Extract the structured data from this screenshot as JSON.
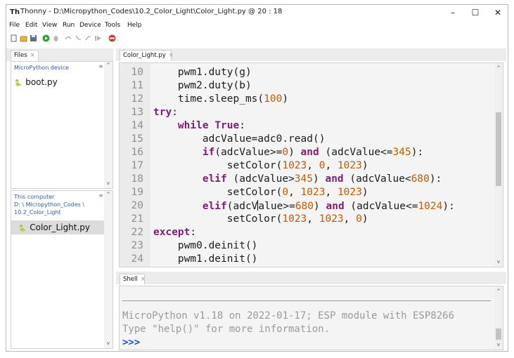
{
  "window": {
    "title": "Thonny  -  D:\\Micropython_Codes\\10.2_Color_Light\\Color_Light.py  @  20 : 18",
    "minimize": "–",
    "maximize": "☐",
    "close": "✕"
  },
  "menu": [
    "File",
    "Edit",
    "View",
    "Run",
    "Device",
    "Tools",
    "Help"
  ],
  "toolbar": {
    "icons": [
      "new-file-icon",
      "open-file-icon",
      "save-icon",
      "run-icon",
      "debug-icon",
      "step-over-icon",
      "step-into-icon",
      "step-out-icon",
      "resume-icon",
      "stop-icon"
    ],
    "run_color": "#2aa32a",
    "stop_color": "#d83a2a"
  },
  "files_tab": {
    "label": "Files",
    "close": "×"
  },
  "device_panel": {
    "header": "MicroPython device",
    "files": [
      "boot.py"
    ]
  },
  "computer_panel": {
    "header_lines": [
      "This computer",
      "D: \\ Micropython_Codes \\",
      "10.2_Color_Light"
    ],
    "files": [
      "Color_Light.py"
    ]
  },
  "editor_tab": {
    "label": "Color_Light.py",
    "close": "×"
  },
  "editor": {
    "lines": [
      {
        "n": "10",
        "indent": "    ",
        "parts": [
          {
            "t": "pwm1.duty(g)",
            "c": ""
          }
        ]
      },
      {
        "n": "11",
        "indent": "    ",
        "parts": [
          {
            "t": "pwm2.duty(b)",
            "c": ""
          }
        ]
      },
      {
        "n": "12",
        "indent": "    ",
        "parts": [
          {
            "t": "time.sleep_ms(",
            "c": ""
          },
          {
            "t": "100",
            "c": "num"
          },
          {
            "t": ")",
            "c": ""
          }
        ]
      },
      {
        "n": "13",
        "indent": "",
        "parts": [
          {
            "t": "try",
            "c": "kw"
          },
          {
            "t": ":",
            "c": ""
          }
        ]
      },
      {
        "n": "14",
        "indent": "    ",
        "parts": [
          {
            "t": "while",
            "c": "kw"
          },
          {
            "t": " ",
            "c": ""
          },
          {
            "t": "True",
            "c": "kw"
          },
          {
            "t": ":",
            "c": ""
          }
        ]
      },
      {
        "n": "15",
        "indent": "        ",
        "parts": [
          {
            "t": "adcValue=adc0.read()",
            "c": ""
          }
        ]
      },
      {
        "n": "16",
        "indent": "        ",
        "parts": [
          {
            "t": "if",
            "c": "kw"
          },
          {
            "t": "(adcValue>=",
            "c": ""
          },
          {
            "t": "0",
            "c": "num"
          },
          {
            "t": ") ",
            "c": ""
          },
          {
            "t": "and",
            "c": "kw"
          },
          {
            "t": " (adcValue<=",
            "c": ""
          },
          {
            "t": "345",
            "c": "num"
          },
          {
            "t": "):",
            "c": ""
          }
        ]
      },
      {
        "n": "17",
        "indent": "            ",
        "parts": [
          {
            "t": "setColor(",
            "c": ""
          },
          {
            "t": "1023",
            "c": "num"
          },
          {
            "t": ", ",
            "c": ""
          },
          {
            "t": "0",
            "c": "num"
          },
          {
            "t": ", ",
            "c": ""
          },
          {
            "t": "1023",
            "c": "num"
          },
          {
            "t": ")",
            "c": ""
          }
        ]
      },
      {
        "n": "18",
        "indent": "        ",
        "parts": [
          {
            "t": "elif",
            "c": "kw"
          },
          {
            "t": " (adcValue>",
            "c": ""
          },
          {
            "t": "345",
            "c": "num"
          },
          {
            "t": ") ",
            "c": ""
          },
          {
            "t": "and",
            "c": "kw"
          },
          {
            "t": " (adcValue<",
            "c": ""
          },
          {
            "t": "680",
            "c": "num"
          },
          {
            "t": "):",
            "c": ""
          }
        ]
      },
      {
        "n": "19",
        "indent": "            ",
        "parts": [
          {
            "t": "setColor(",
            "c": ""
          },
          {
            "t": "0",
            "c": "num"
          },
          {
            "t": ", ",
            "c": ""
          },
          {
            "t": "1023",
            "c": "num"
          },
          {
            "t": ", ",
            "c": ""
          },
          {
            "t": "1023",
            "c": "num"
          },
          {
            "t": ")",
            "c": ""
          }
        ]
      },
      {
        "n": "20",
        "indent": "        ",
        "parts": [
          {
            "t": "elif",
            "c": "kw"
          },
          {
            "t": "(adcV",
            "c": ""
          },
          {
            "t": "|",
            "c": "cursor"
          },
          {
            "t": "alue>=",
            "c": ""
          },
          {
            "t": "680",
            "c": "num"
          },
          {
            "t": ") ",
            "c": ""
          },
          {
            "t": "and",
            "c": "kw"
          },
          {
            "t": " (adcValue<=",
            "c": ""
          },
          {
            "t": "1024",
            "c": "num"
          },
          {
            "t": "):",
            "c": ""
          }
        ]
      },
      {
        "n": "21",
        "indent": "            ",
        "parts": [
          {
            "t": "setColor(",
            "c": ""
          },
          {
            "t": "1023",
            "c": "num"
          },
          {
            "t": ", ",
            "c": ""
          },
          {
            "t": "1023",
            "c": "num"
          },
          {
            "t": ", ",
            "c": ""
          },
          {
            "t": "0",
            "c": "num"
          },
          {
            "t": ")",
            "c": ""
          }
        ]
      },
      {
        "n": "22",
        "indent": "",
        "parts": [
          {
            "t": "except",
            "c": "kw"
          },
          {
            "t": ":",
            "c": ""
          }
        ]
      },
      {
        "n": "23",
        "indent": "    ",
        "parts": [
          {
            "t": "pwm0.deinit()",
            "c": ""
          }
        ]
      },
      {
        "n": "24",
        "indent": "    ",
        "parts": [
          {
            "t": "pwm1.deinit()",
            "c": ""
          }
        ]
      }
    ]
  },
  "shell_tab": {
    "label": "Shell",
    "close": "×"
  },
  "shell": {
    "lines": [
      "MicroPython v1.18 on 2022-01-17; ESP module with ESP8266",
      "Type \"help()\" for more information."
    ],
    "prompt": ">>>"
  }
}
